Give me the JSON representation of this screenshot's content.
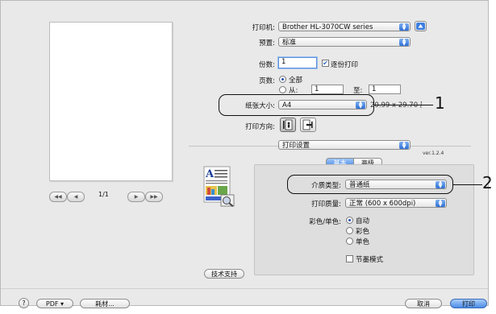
{
  "printer": {
    "label": "打印机:",
    "value": "Brother HL-3070CW series"
  },
  "presets": {
    "label": "预置:",
    "value": "标准"
  },
  "copies": {
    "label": "份数:",
    "value": "1",
    "collate_label": "逐份打印"
  },
  "pages": {
    "label": "页数:",
    "all_label": "全部",
    "from_label": "从:",
    "from_value": "1",
    "to_label": "至:",
    "to_value": "1"
  },
  "paper_size": {
    "label": "纸张大小:",
    "value": "A4",
    "dimensions": "20.99 x 29.70 厘米"
  },
  "orientation": {
    "label": "打印方向:"
  },
  "panel": {
    "value": "打印设置",
    "version": "ver.1.2.4"
  },
  "tabs": [
    {
      "label": "基本"
    },
    {
      "label": "高级"
    }
  ],
  "media_type": {
    "label": "介质类型:",
    "value": "普通纸"
  },
  "print_quality": {
    "label": "打印质量:",
    "value": "正常 (600 x 600dpi)"
  },
  "color_mode": {
    "label": "彩色/单色:",
    "options": [
      "自动",
      "彩色",
      "单色"
    ]
  },
  "toner_save": {
    "label": "节墨模式"
  },
  "support_button": "技术支持",
  "preview_nav": {
    "page_indicator": "1/1",
    "first": "◀◀",
    "prev": "◀",
    "next": "▶",
    "last": "▶▶"
  },
  "footer": {
    "help": "?",
    "pdf": "PDF ▾",
    "supplies": "耗材...",
    "cancel": "取消",
    "print": "打印"
  },
  "callouts": {
    "one": "1",
    "two": "2"
  },
  "colors": {
    "accent": "#4b8be6",
    "window": "#e9e9e9"
  }
}
